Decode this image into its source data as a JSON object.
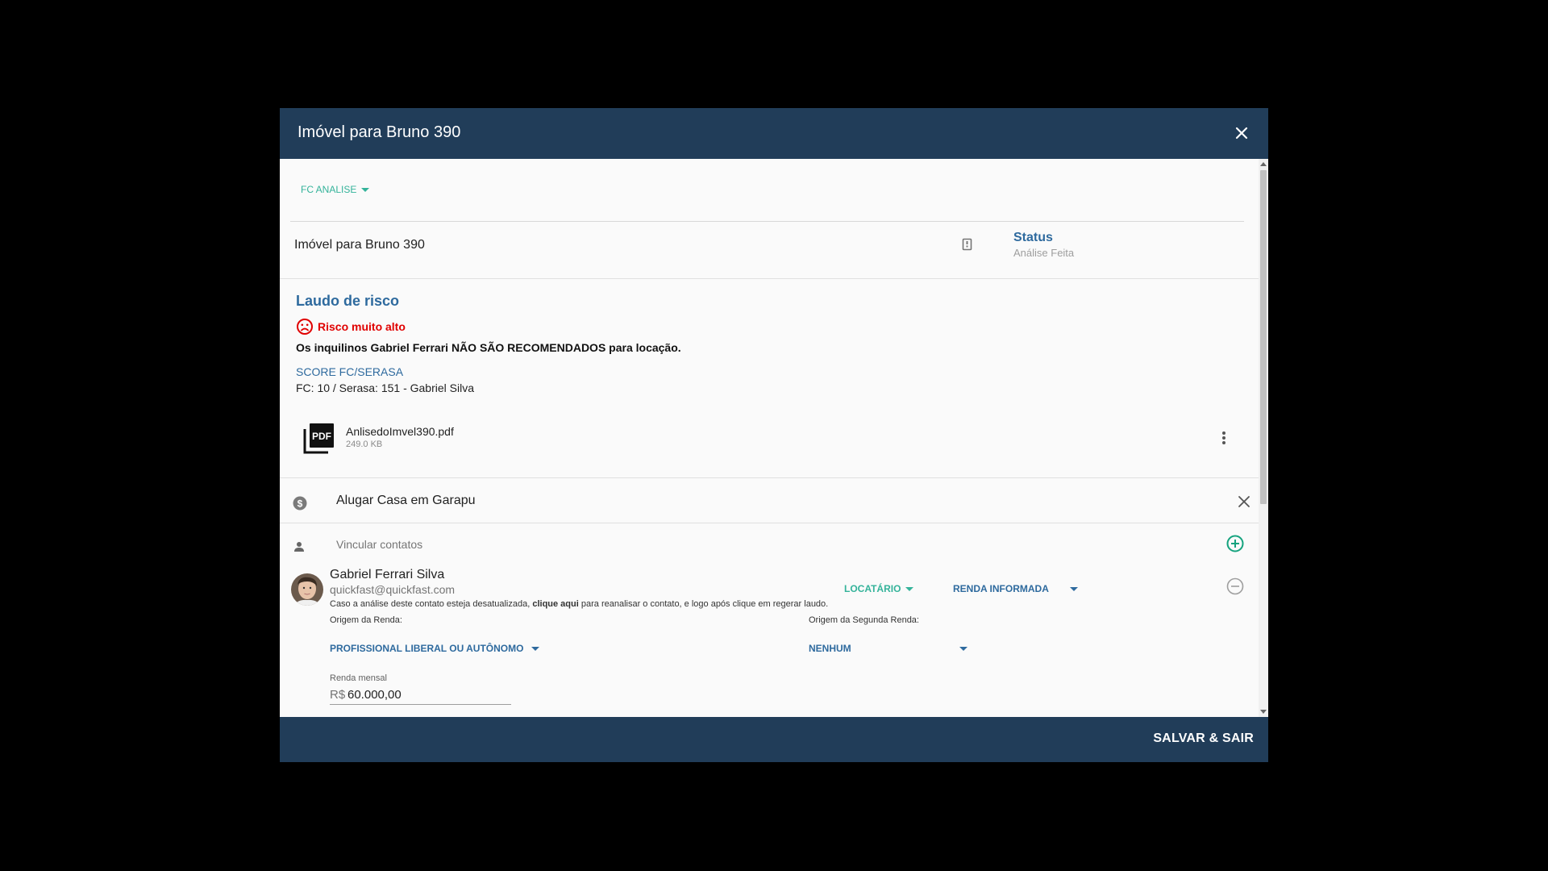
{
  "modal": {
    "title": "Imóvel para Bruno 390",
    "save_label": "SALVAR & SAIR"
  },
  "pipeline": {
    "selected": "FC ANALISE"
  },
  "property": {
    "name": "Imóvel para Bruno 390",
    "status_label": "Status",
    "status_value": "Análise Feita"
  },
  "laudo": {
    "title": "Laudo de risco",
    "risk_level": "Risco muito alto",
    "message": "Os inquilinos Gabriel Ferrari NÃO SÃO RECOMENDADOS para locação.",
    "score_label": "SCORE FC/SERASA",
    "score_value": "FC: 10 / Serasa: 151 - Gabriel Silva"
  },
  "attachment": {
    "filename": "AnlisedoImvel390.pdf",
    "size": "249.0 KB"
  },
  "deal": {
    "name": "Alugar Casa em Garapu"
  },
  "contacts": {
    "placeholder": "Vincular contatos",
    "items": [
      {
        "name": "Gabriel Ferrari Silva",
        "email": "quickfast@quickfast.com",
        "note_before": "Caso a análise deste contato esteja desatualizada, ",
        "note_link": "clique aqui",
        "note_after": " para reanalisar o contato, e logo após clique em regerar laudo.",
        "role": "LOCATÁRIO",
        "income_type": "RENDA INFORMADA",
        "origem_label": "Origem da Renda:",
        "origem_value": "PROFISSIONAL LIBERAL OU AUTÔNOMO",
        "origem2_label": "Origem da Segunda Renda:",
        "origem2_value": "NENHUM",
        "renda_label": "Renda mensal",
        "renda_prefix": "R$",
        "renda_value": "60.000,00"
      }
    ]
  },
  "colors": {
    "header": "#213d59",
    "accent_green": "#34b39a",
    "accent_blue": "#2e6a9e",
    "risk_red": "#e00000"
  },
  "icons": [
    "close-icon",
    "document-icon",
    "sad-face-icon",
    "pdf-icon",
    "more-vert-icon",
    "dollar-icon",
    "person-icon",
    "add-circle-icon",
    "remove-circle-icon"
  ]
}
